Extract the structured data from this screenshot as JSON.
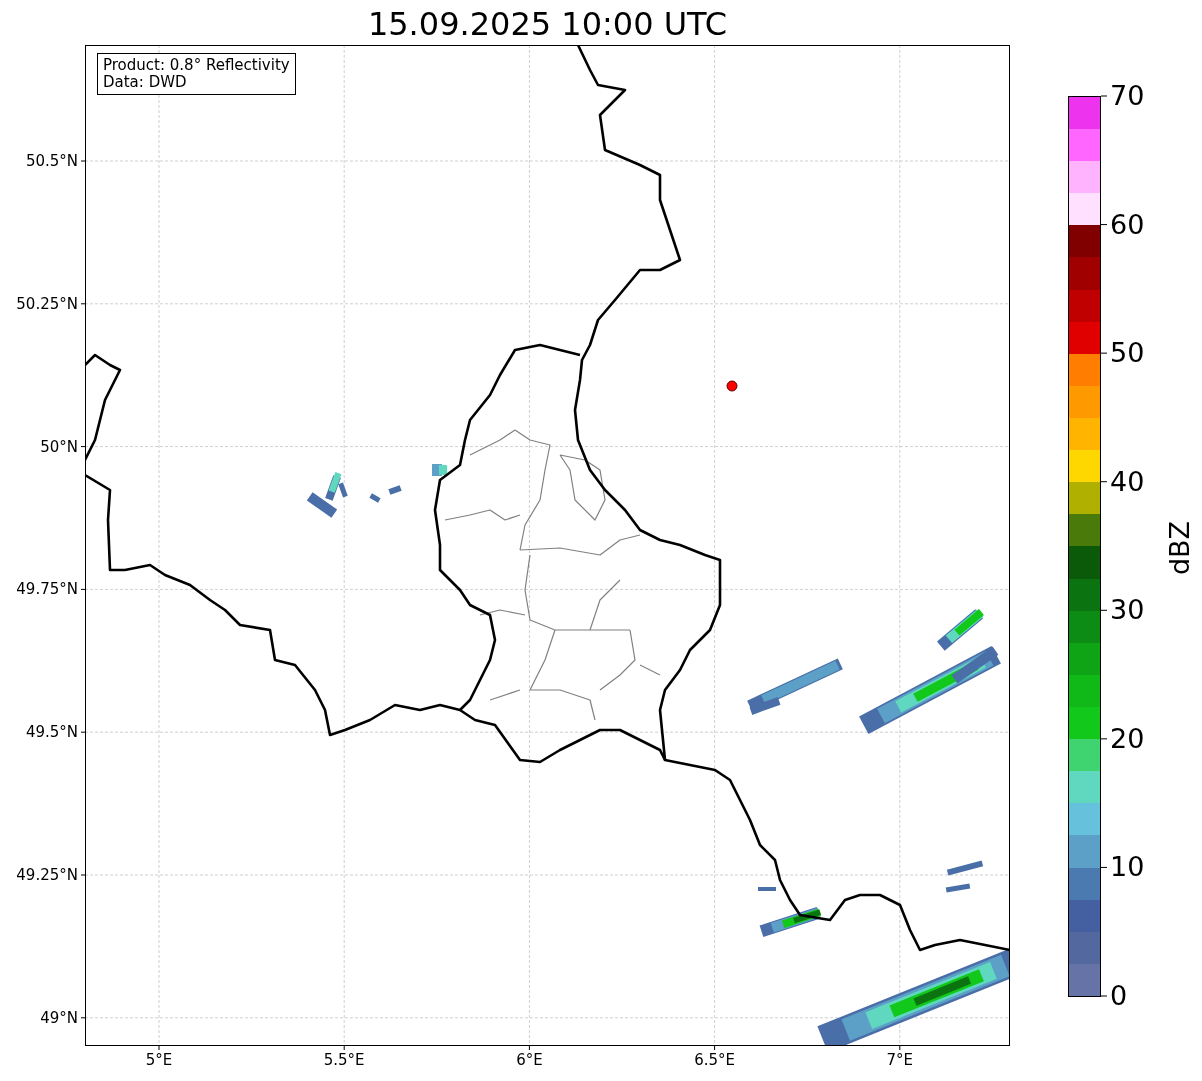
{
  "title": "15.09.2025 10:00 UTC",
  "info": [
    "Product: 0.8° Reflectivity",
    "Data: DWD"
  ],
  "map": {
    "latitude_ticks": [
      "50.5°N",
      "50.25°N",
      "50°N",
      "49.75°N",
      "49.5°N",
      "49.25°N",
      "49°N"
    ],
    "longitude_ticks": [
      "5°E",
      "5.5°E",
      "6°E",
      "6.5°E",
      "7°E"
    ]
  },
  "colorbar": {
    "label": "dBZ",
    "ticks": [
      "70",
      "60",
      "50",
      "40",
      "30",
      "20",
      "10",
      "0"
    ],
    "bins": [
      {
        "color": "#6673a6"
      },
      {
        "color": "#5468a0"
      },
      {
        "color": "#4560a0"
      },
      {
        "color": "#4a7ab0"
      },
      {
        "color": "#5ca0c8"
      },
      {
        "color": "#66c2dc"
      },
      {
        "color": "#60d8c0"
      },
      {
        "color": "#40d470"
      },
      {
        "color": "#12c81a"
      },
      {
        "color": "#10b818"
      },
      {
        "color": "#0ea416"
      },
      {
        "color": "#0c8c14"
      },
      {
        "color": "#0b7410"
      },
      {
        "color": "#0a5a0a"
      },
      {
        "color": "#4a7a0a"
      },
      {
        "color": "#b0b000"
      },
      {
        "color": "#ffd700"
      },
      {
        "color": "#ffb400"
      },
      {
        "color": "#ff9900"
      },
      {
        "color": "#ff7d00"
      },
      {
        "color": "#e00000"
      },
      {
        "color": "#c00000"
      },
      {
        "color": "#a00000"
      },
      {
        "color": "#800000"
      },
      {
        "color": "#ffe0ff"
      },
      {
        "color": "#ffb3ff"
      },
      {
        "color": "#ff66ff"
      },
      {
        "color": "#ee33ee"
      }
    ]
  }
}
